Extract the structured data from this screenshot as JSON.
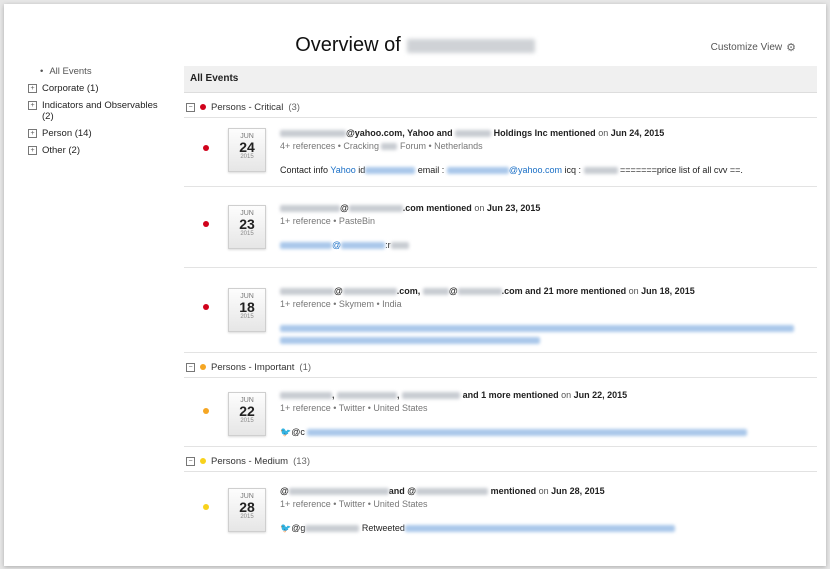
{
  "page": {
    "title": "Overview of",
    "customize_label": "Customize View"
  },
  "sidebar": {
    "items": [
      {
        "label": "All Events"
      },
      {
        "label": "Corporate (1)"
      },
      {
        "label": "Indicators and Observables (2)"
      },
      {
        "label": "Person (14)"
      },
      {
        "label": "Other (2)"
      }
    ]
  },
  "main": {
    "header": "All Events",
    "groups": [
      {
        "name": "Persons - Critical",
        "count": "(3)",
        "color": "#d0021b"
      },
      {
        "name": "Persons - Important",
        "count": "(1)",
        "color": "#f5a623"
      },
      {
        "name": "Persons - Medium",
        "count": "(13)",
        "color": "#f8d21c"
      }
    ],
    "events": [
      {
        "month": "JUN",
        "day": "24",
        "year": "2015",
        "title_a": "@yahoo.com, Yahoo and",
        "title_b": "Holdings Inc mentioned",
        "on": "on",
        "date": "Jun 24, 2015",
        "meta_a": "4+ references • Cracking",
        "meta_b": "Forum • Netherlands",
        "content_a": "Contact info",
        "content_link": "Yahoo",
        "content_b": "id",
        "content_c": "email :",
        "content_d": "@yahoo.com",
        "content_e": "icq :",
        "content_f": "=======price list of all cvv ==."
      },
      {
        "month": "JUN",
        "day": "23",
        "year": "2015",
        "title_a": "@",
        "title_b": ".com mentioned",
        "on": "on",
        "date": "Jun 23, 2015",
        "meta": "1+ reference • PasteBin",
        "content_a": "@",
        "content_b": ":r"
      },
      {
        "month": "JUN",
        "day": "18",
        "year": "2015",
        "title_a": "@",
        "title_b": ".com,",
        "title_c": "@",
        "title_d": ".com and 21 more mentioned",
        "on": "on",
        "date": "Jun 18, 2015",
        "meta": "1+ reference • Skymem • India"
      },
      {
        "month": "JUN",
        "day": "22",
        "year": "2015",
        "title_a": ",",
        "title_b": ",",
        "title_c": "and 1 more mentioned",
        "on": "on",
        "date": "Jun 22, 2015",
        "meta": "1+ reference • Twitter • United States",
        "content_a": "@c"
      },
      {
        "month": "JUN",
        "day": "28",
        "year": "2015",
        "title_a": "@",
        "title_b": "and @",
        "title_c": "mentioned",
        "on": "on",
        "date": "Jun 28, 2015",
        "meta": "1+ reference • Twitter • United States",
        "content_a": "@g",
        "content_b": "Retweeted"
      }
    ]
  }
}
